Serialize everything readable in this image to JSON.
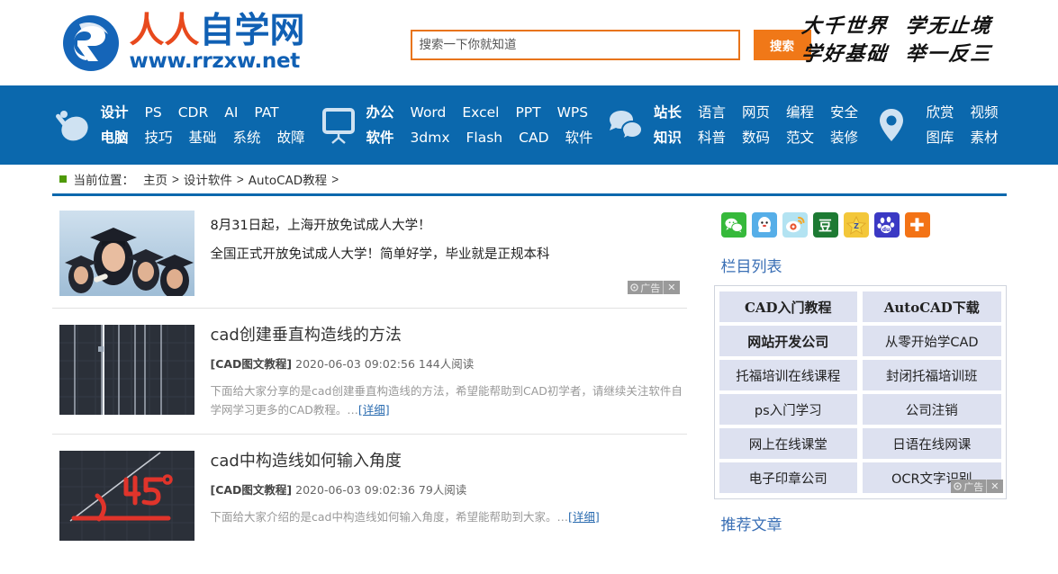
{
  "header": {
    "logo": {
      "cn_orange": "人人",
      "cn_blue": "自学网",
      "url": "www.rrzxw.net",
      "mark": "r-logo-icon"
    },
    "search": {
      "placeholder": "搜索一下你就知道",
      "value": "",
      "button_label": "搜索"
    },
    "slogan_line1": "大千世界  学无止境",
    "slogan_line2": "学好基础  举一反三"
  },
  "nav": {
    "groups": [
      {
        "icon": "satellite-dish-icon",
        "row1": [
          "设计",
          "PS",
          "CDR",
          "AI",
          "PAT"
        ],
        "row2": [
          "电脑",
          "技巧",
          "基础",
          "系统",
          "故障"
        ]
      },
      {
        "icon": "monitor-board-icon",
        "row1": [
          "办公",
          "Word",
          "Excel",
          "PPT",
          "WPS"
        ],
        "row2": [
          "软件",
          "3dmx",
          "Flash",
          "CAD",
          "软件"
        ]
      },
      {
        "icon": "chat-bubbles-icon",
        "row1": [
          "站长",
          "语言",
          "网页",
          "编程",
          "安全"
        ],
        "row2": [
          "知识",
          "科普",
          "数码",
          "范文",
          "装修"
        ]
      },
      {
        "icon": "location-pin-icon",
        "row1": [
          "欣赏",
          "视频"
        ],
        "row2": [
          "图库",
          "素材"
        ]
      }
    ]
  },
  "breadcrumb": {
    "label": "当前位置：",
    "items": [
      "主页",
      "设计软件",
      "AutoCAD教程"
    ],
    "separator": ">",
    "trailing": ">"
  },
  "ad_banner": {
    "title": "8月31日起，上海开放免试成人大学！",
    "desc": "全国正式开放免试成人大学！简单好学，毕业就是正规本科",
    "badge_text": "广告",
    "badge_close": "✕",
    "thumb": "graduates-photo"
  },
  "articles": [
    {
      "title": "cad创建垂直构造线的方法",
      "category": "[CAD图文教程]",
      "date": "2020-06-03 09:02:56",
      "reads": "144人阅读",
      "desc": "下面给大家分享的是cad创建垂直构造线的方法，希望能帮助到CAD初学者，请继续关注软件自学网学习更多的CAD教程。…",
      "more": "[详细]",
      "thumb": "cad-vertical-lines-screenshot"
    },
    {
      "title": "cad中构造线如何输入角度",
      "category": "[CAD图文教程]",
      "date": "2020-06-03 09:02:36",
      "reads": "79人阅读",
      "desc": "下面给大家介绍的是cad中构造线如何输入角度，希望能帮助到大家。…",
      "more": "[详细]",
      "thumb": "cad-45-degree-screenshot"
    }
  ],
  "sidebar": {
    "share_icons": [
      {
        "name": "wechat-icon",
        "glyph": "💬",
        "color": "#36b93b"
      },
      {
        "name": "qq-icon",
        "glyph": "🐧",
        "color": "#56aee8"
      },
      {
        "name": "weibo-icon",
        "glyph": "◉",
        "color": "#9fdcf0"
      },
      {
        "name": "douban-icon",
        "glyph": "豆",
        "color": "#1d7a33"
      },
      {
        "name": "qzone-icon",
        "glyph": "★",
        "color": "#f7cf37"
      },
      {
        "name": "baidu-icon",
        "glyph": "du",
        "color": "#3b39c4"
      },
      {
        "name": "more-share-icon",
        "glyph": "✚",
        "color": "#f37316"
      }
    ],
    "section_title": "栏目列表",
    "categories": [
      "CAD入门教程",
      "AutoCAD下载",
      "网站开发公司",
      "从零开始学CAD",
      "托福培训在线课程",
      "封闭托福培训班",
      "ps入门学习",
      "公司注销",
      "网上在线课堂",
      "日语在线网课",
      "电子印章公司",
      "OCR文字识别"
    ],
    "ad_badge_text": "广告",
    "ad_badge_close": "✕",
    "recommend_title": "推荐文章"
  }
}
